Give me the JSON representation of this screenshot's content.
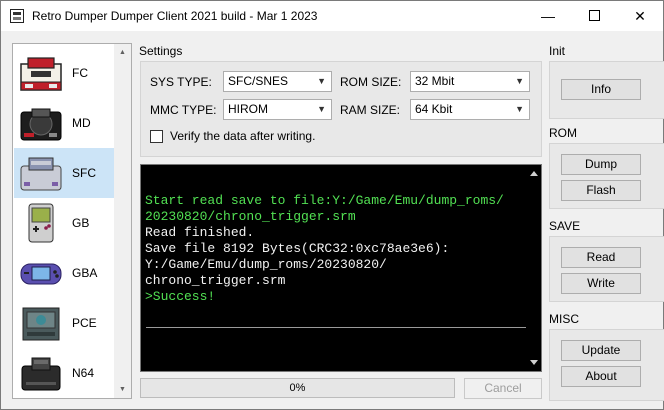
{
  "window": {
    "title": "Retro Dumper Dumper Client 2021 build - Mar  1 2023",
    "minimize": "—",
    "close": "✕"
  },
  "sidebar": {
    "items": [
      {
        "label": "FC",
        "icon": "famicom-console-icon",
        "selected": false
      },
      {
        "label": "MD",
        "icon": "mega-drive-console-icon",
        "selected": false
      },
      {
        "label": "SFC",
        "icon": "super-famicom-console-icon",
        "selected": true
      },
      {
        "label": "GB",
        "icon": "game-boy-icon",
        "selected": false
      },
      {
        "label": "GBA",
        "icon": "game-boy-advance-icon",
        "selected": false
      },
      {
        "label": "PCE",
        "icon": "pc-engine-console-icon",
        "selected": false
      },
      {
        "label": "N64",
        "icon": "nintendo-64-console-icon",
        "selected": false
      }
    ]
  },
  "settings": {
    "title": "Settings",
    "sys_type_label": "SYS TYPE:",
    "sys_type_value": "SFC/SNES",
    "mmc_type_label": "MMC TYPE:",
    "mmc_type_value": "HIROM",
    "rom_size_label": "ROM SIZE:",
    "rom_size_value": "32 Mbit",
    "ram_size_label": "RAM SIZE:",
    "ram_size_value": "64 Kbit",
    "verify_label": "Verify the data after writing.",
    "verify_checked": false
  },
  "console": {
    "lines": [
      {
        "text": "Start read save to file:Y:/Game/Emu/dump_roms/",
        "color": "#52e053"
      },
      {
        "text": "20230820/chrono_trigger.srm",
        "color": "#52e053"
      },
      {
        "text": "Read finished.",
        "color": "#f2f2f2"
      },
      {
        "text": "Save file 8192 Bytes(CRC32:0xc78ae3e6):",
        "color": "#f2f2f2"
      },
      {
        "text": "Y:/Game/Emu/dump_roms/20230820/",
        "color": "#f2f2f2"
      },
      {
        "text": "chrono_trigger.srm",
        "color": "#f2f2f2"
      },
      {
        "text": ">Success!",
        "color": "#52e053"
      }
    ]
  },
  "progress": {
    "value_percent": 0,
    "label": "0%"
  },
  "cancel_label": "Cancel",
  "panel": {
    "init_title": "Init",
    "info_label": "Info",
    "rom_title": "ROM",
    "dump_label": "Dump",
    "flash_label": "Flash",
    "save_title": "SAVE",
    "read_label": "Read",
    "write_label": "Write",
    "misc_title": "MISC",
    "update_label": "Update",
    "about_label": "About"
  }
}
